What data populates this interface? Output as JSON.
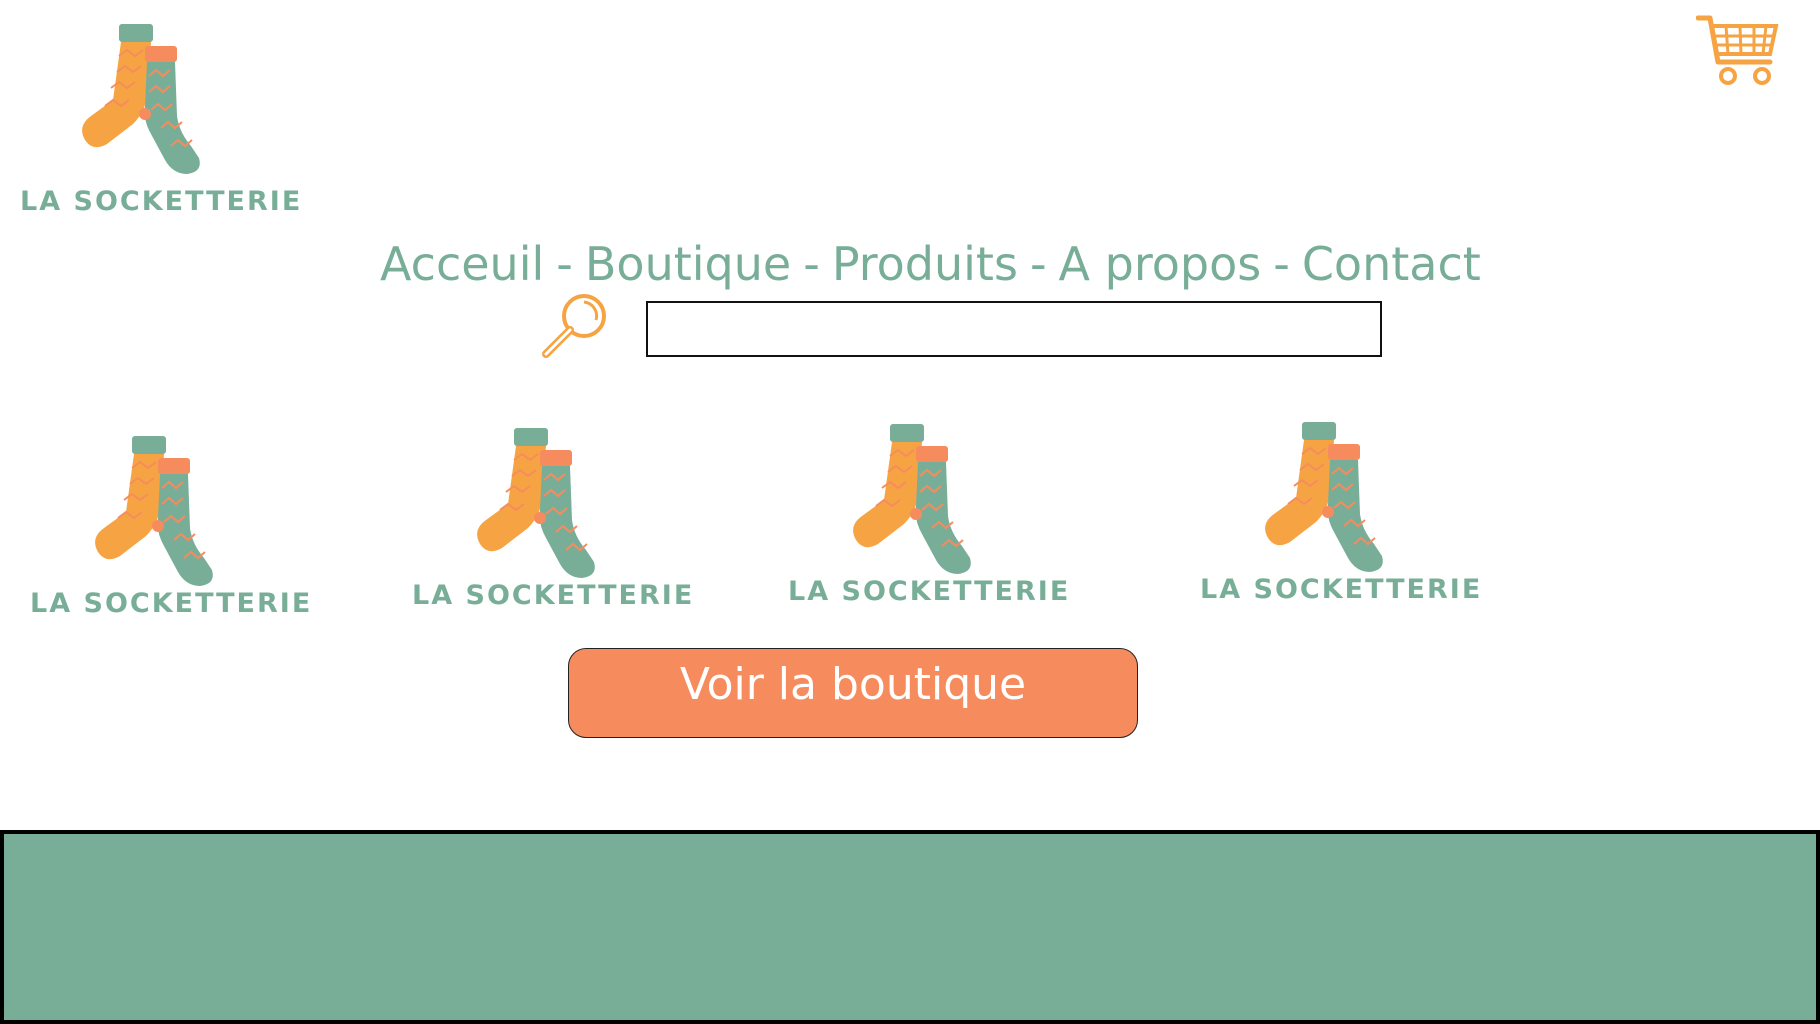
{
  "brand": {
    "name": "LA SOCKETTERIE",
    "colors": {
      "green": "#78ae98",
      "orange": "#f6a443",
      "coral": "#f68c5e"
    }
  },
  "header": {
    "cart_icon": "shopping-cart-icon"
  },
  "nav": {
    "items": [
      "Acceuil",
      "Boutique",
      "Produits",
      "A propos",
      "Contact"
    ],
    "separator": "-"
  },
  "search": {
    "icon": "magnifying-glass-icon",
    "value": "",
    "placeholder": ""
  },
  "products": [
    {
      "label": "LA SOCKETTERIE"
    },
    {
      "label": "LA SOCKETTERIE"
    },
    {
      "label": "LA SOCKETTERIE"
    },
    {
      "label": "LA SOCKETTERIE"
    }
  ],
  "cta": {
    "label": "Voir la boutique"
  }
}
